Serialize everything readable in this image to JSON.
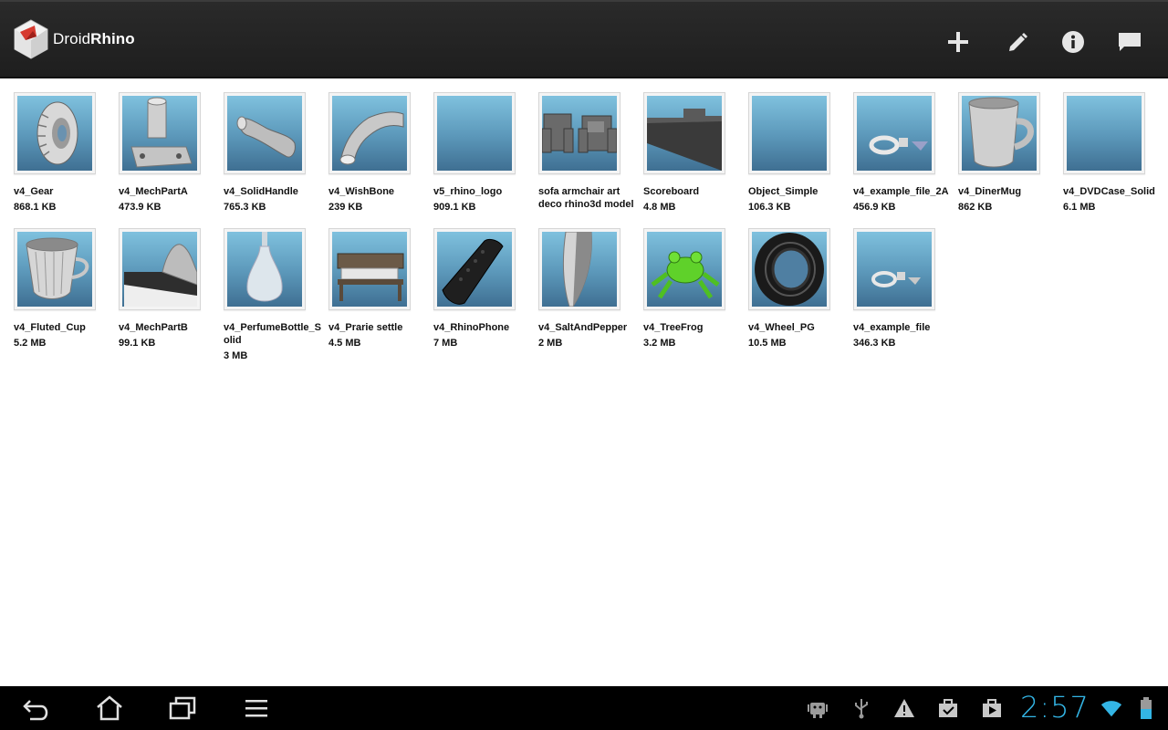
{
  "app": {
    "title_regular": "Droid",
    "title_bold": "Rhino"
  },
  "actions": [
    {
      "name": "add-icon"
    },
    {
      "name": "edit-icon"
    },
    {
      "name": "info-icon"
    },
    {
      "name": "message-icon"
    }
  ],
  "files": [
    {
      "name": "v4_Gear",
      "size": "868.1 KB"
    },
    {
      "name": "v4_MechPartA",
      "size": "473.9 KB"
    },
    {
      "name": "v4_SolidHandle",
      "size": "765.3 KB"
    },
    {
      "name": "v4_WishBone",
      "size": "239 KB"
    },
    {
      "name": "v5_rhino_logo",
      "size": "909.1 KB"
    },
    {
      "name": "sofa armchair art deco rhino3d model",
      "size": ""
    },
    {
      "name": "Scoreboard",
      "size": "4.8 MB"
    },
    {
      "name": "Object_Simple",
      "size": "106.3 KB"
    },
    {
      "name": "v4_example_file_2A",
      "size": "456.9 KB"
    },
    {
      "name": "v4_DinerMug",
      "size": "862 KB"
    },
    {
      "name": "v4_DVDCase_Solid",
      "size": "6.1 MB"
    },
    {
      "name": "v4_Fluted_Cup",
      "size": "5.2 MB"
    },
    {
      "name": "v4_MechPartB",
      "size": "99.1 KB"
    },
    {
      "name": "v4_PerfumeBottle_Solid",
      "size": "3 MB"
    },
    {
      "name": "v4_Prarie settle",
      "size": "4.5 MB"
    },
    {
      "name": "v4_RhinoPhone",
      "size": "7 MB"
    },
    {
      "name": "v4_SaltAndPepper",
      "size": "2 MB"
    },
    {
      "name": "v4_TreeFrog",
      "size": "3.2 MB"
    },
    {
      "name": "v4_Wheel_PG",
      "size": "10.5 MB"
    },
    {
      "name": "v4_example_file",
      "size": "346.3 KB"
    }
  ],
  "status": {
    "clock": "2:57"
  },
  "colors": {
    "accent": "#33b5e5",
    "actionbar": "#222222",
    "thumb_top": "#7fc1de",
    "thumb_bottom": "#3f6f92"
  }
}
